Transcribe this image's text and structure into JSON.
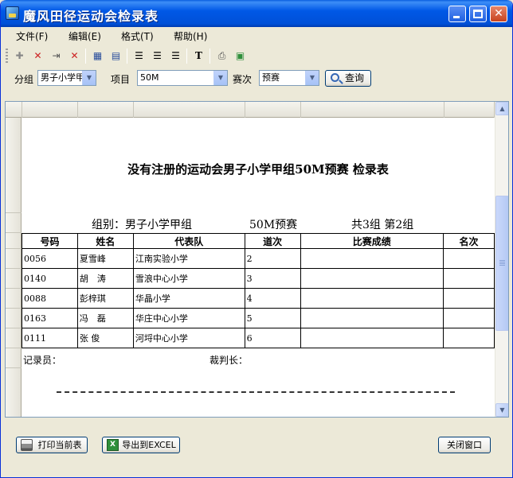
{
  "window": {
    "title": "魔风田径运动会检录表"
  },
  "menu": [
    {
      "label": "文件(F)"
    },
    {
      "label": "编辑(E)"
    },
    {
      "label": "格式(T)"
    },
    {
      "label": "帮助(H)"
    }
  ],
  "filters": {
    "group_label": "分组",
    "group_value": "男子小学甲组",
    "event_label": "项目",
    "event_value": "50M",
    "round_label": "赛次",
    "round_value": "预赛",
    "query_label": "查询"
  },
  "report": {
    "title": "没有注册的运动会男子小学甲组50M预赛 检录表",
    "group_text": "组别：男子小学甲组",
    "event_round": "50M预赛",
    "group_count": "共3组 第2组",
    "columns": [
      "号码",
      "姓名",
      "代表队",
      "道次",
      "比赛成绩",
      "名次"
    ],
    "rows": [
      {
        "number": "0056",
        "name": "夏雪峰",
        "team": "江南实验小学",
        "lane": "2",
        "result": "",
        "rank": ""
      },
      {
        "number": "0140",
        "name": "胡　涛",
        "team": "雪浪中心小学",
        "lane": "3",
        "result": "",
        "rank": ""
      },
      {
        "number": "0088",
        "name": "彭梓琪",
        "team": "华晶小学",
        "lane": "4",
        "result": "",
        "rank": ""
      },
      {
        "number": "0163",
        "name": "冯　磊",
        "team": "华庄中心小学",
        "lane": "5",
        "result": "",
        "rank": ""
      },
      {
        "number": "0111",
        "name": "张 俊",
        "team": "河埒中心小学",
        "lane": "6",
        "result": "",
        "rank": ""
      }
    ],
    "recorder_label": "记录员：",
    "referee_label": "裁判长："
  },
  "buttons": {
    "print": "打印当前表",
    "export": "导出到EXCEL",
    "close": "关闭窗口"
  },
  "colors": {
    "title_bar": "#0058e6",
    "window_bg": "#ece9d8"
  }
}
